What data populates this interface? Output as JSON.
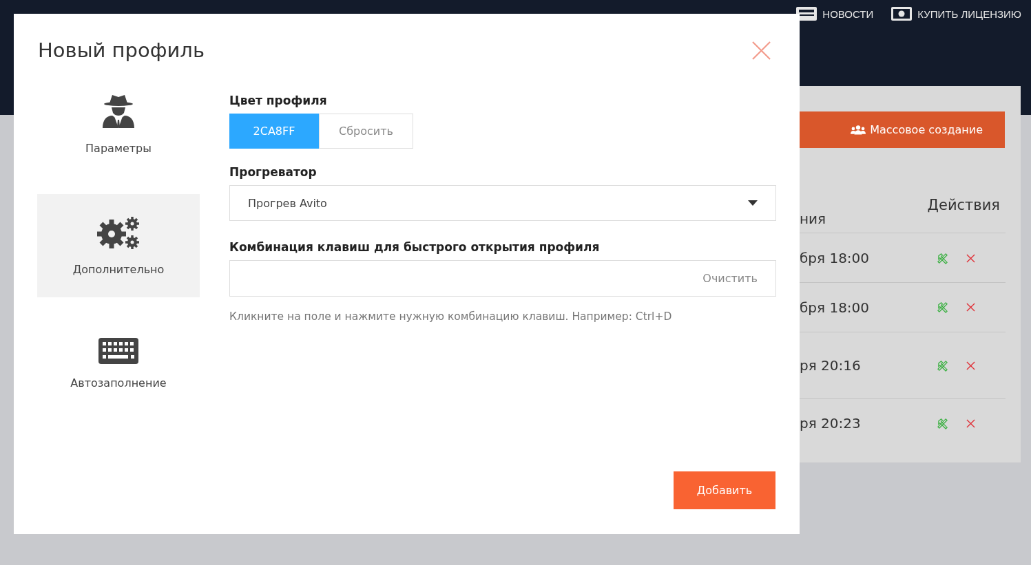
{
  "nav": [
    {
      "label": "НОВОСТИ"
    },
    {
      "label": "КУПИТЬ ЛИЦЕНЗИЮ"
    }
  ],
  "panel": {
    "mass_button": "Массовое создание",
    "columns": [
      "ния",
      "Действия"
    ],
    "rows": [
      {
        "date": "бря 18:00"
      },
      {
        "date": "бря 18:00"
      },
      {
        "date": "ря 20:16"
      },
      {
        "date": "ря 20:23"
      }
    ]
  },
  "modal": {
    "title": "Новый профиль",
    "sections": [
      {
        "label": "Параметры",
        "selected": false
      },
      {
        "label": "Дополнительно",
        "selected": true
      },
      {
        "label": "Автозаполнение",
        "selected": false
      }
    ],
    "color_label": "Цвет профиля",
    "color_value": "2CA8FF",
    "reset_button": "Сбросить",
    "warmer_label": "Прогреватор",
    "warmer_value": "Прогрев Avito",
    "hotkey_label": "Комбинация клавиш для быстрого открытия профиля",
    "hotkey_clear": "Очистить",
    "hotkey_hint": "Кликните на поле и нажмите нужную комбинацию клавиш. Например: Ctrl+D",
    "add_button": "Добавить"
  }
}
